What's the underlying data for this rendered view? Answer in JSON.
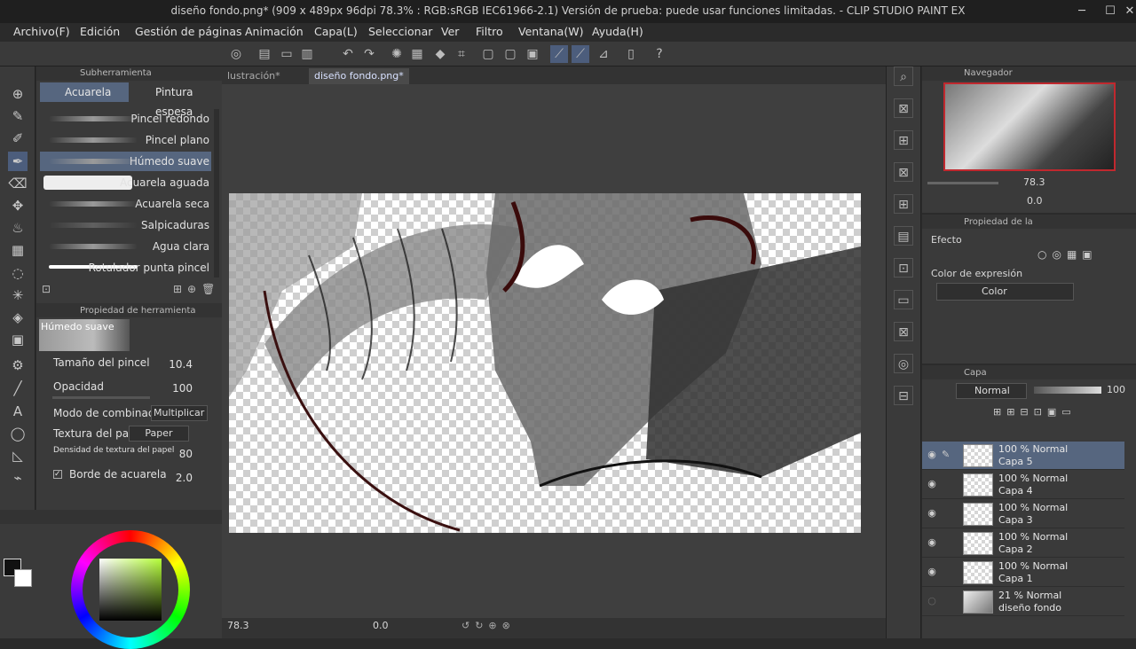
{
  "window": {
    "title": "diseño fondo.png* (909 x 489px 96dpi 78.3% : RGB:sRGB IEC61966-2.1)  Versión de prueba: puede usar funciones limitadas. - CLIP STUDIO PAINT EX",
    "minimize": "─",
    "maximize": "☐",
    "close": "✕"
  },
  "menu": [
    "Archivo(F)",
    "Edición",
    "Gestión de páginas",
    "Animación",
    "Capa(L)",
    "Seleccionar",
    "Ver",
    "Filtro",
    "Ventana(W)",
    "Ayuda(H)"
  ],
  "subtool": {
    "header": "Subherramienta",
    "tabs": [
      "Acuarela",
      "Pintura espesa"
    ],
    "brushes": [
      "Pincel redondo",
      "Pincel plano",
      "Húmedo suave",
      "Acuarela aguada",
      "Acuarela seca",
      "Salpicaduras",
      "Agua clara",
      "Rotulador punta pincel"
    ],
    "selected": "Húmedo suave"
  },
  "toolprop": {
    "header": "Propiedad de herramienta",
    "preview_label": "Húmedo suave",
    "rows": [
      {
        "label": "Tamaño del pincel",
        "value": "10.4"
      },
      {
        "label": "Opacidad",
        "value": "100"
      },
      {
        "label": "Modo de combinación",
        "value": "Multiplicar"
      },
      {
        "label": "Textura del papel",
        "value": "Paper"
      },
      {
        "label": "Densidad de textura del papel",
        "value": "80"
      },
      {
        "label": "Borde de acuarela",
        "value": "2.0"
      }
    ]
  },
  "doctabs": [
    "lustración*",
    "diseño fondo.png*"
  ],
  "status": {
    "zoom": "78.3",
    "rotation": "0.0"
  },
  "navigator": {
    "header": "Navegador",
    "zoom": "78.3",
    "rotation": "0.0"
  },
  "layerprop": {
    "header": "Propiedad de la",
    "effect_label": "Efecto",
    "expression_label": "Color de expresión",
    "expression_value": "Color"
  },
  "layers": {
    "header": "Capa",
    "blend": "Normal",
    "opacity": "100",
    "list": [
      {
        "mode": "100 % Normal",
        "name": "Capa 5",
        "selected": true
      },
      {
        "mode": "100 % Normal",
        "name": "Capa 4"
      },
      {
        "mode": "100 % Normal",
        "name": "Capa 3"
      },
      {
        "mode": "100 % Normal",
        "name": "Capa 2"
      },
      {
        "mode": "100 % Normal",
        "name": "Capa 1"
      },
      {
        "mode": "21 % Normal",
        "name": "diseño fondo"
      }
    ]
  },
  "colors": {
    "accent": "#56667f",
    "main": "#111111",
    "sub": "#ffffff"
  }
}
